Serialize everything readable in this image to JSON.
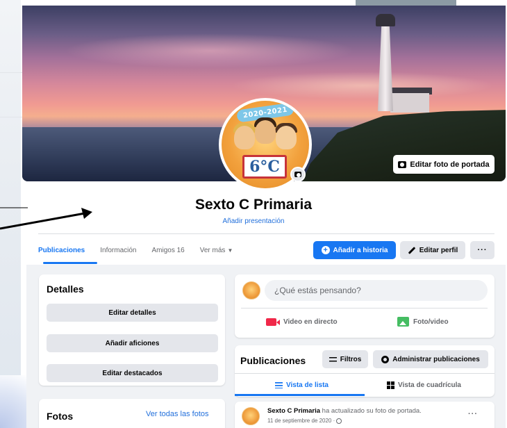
{
  "cover": {
    "edit_cover_label": "Editar foto de portada"
  },
  "avatar": {
    "banner_text": "2020-2021",
    "board_text": "6°C"
  },
  "profile": {
    "name": "Sexto C Primaria",
    "add_bio_link": "Añadir presentación"
  },
  "tabs": [
    {
      "label": "Publicaciones",
      "active": true
    },
    {
      "label": "Información",
      "active": false
    },
    {
      "label": "Amigos 16",
      "active": false
    },
    {
      "label": "Ver más",
      "active": false
    }
  ],
  "actions": {
    "add_story_label": "Añadir a historia",
    "edit_profile_label": "Editar perfil",
    "more_label": "···"
  },
  "details_card": {
    "title": "Detalles",
    "buttons": [
      "Editar detalles",
      "Añadir aficiones",
      "Editar destacados"
    ]
  },
  "photos_card": {
    "title": "Fotos",
    "see_all_link": "Ver todas las fotos"
  },
  "composer": {
    "placeholder": "¿Qué estás pensando?",
    "live_video_label": "Video en directo",
    "photo_video_label": "Foto/video"
  },
  "posts_card": {
    "title": "Publicaciones",
    "filters_label": "Filtros",
    "manage_label": "Administrar publicaciones",
    "list_view_label": "Vista de lista",
    "grid_view_label": "Vista de cuadrícula"
  },
  "post": {
    "author": "Sexto C Primaria",
    "action_text": " ha actualizado su foto de portada.",
    "date": "11 de septiembre de 2020 ·",
    "more_label": "···"
  },
  "colors": {
    "accent": "#1877f2",
    "link": "#216fdb",
    "button_gray": "#e4e6eb",
    "page_bg": "#f0f2f5"
  }
}
